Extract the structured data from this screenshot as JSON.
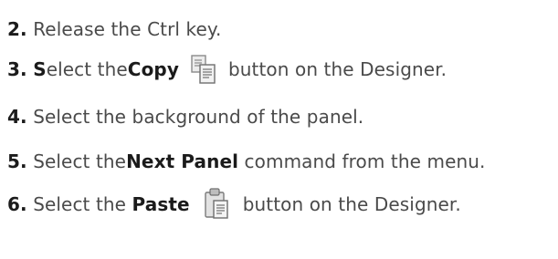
{
  "steps": [
    {
      "number": "2.",
      "before": "Release the Ctrl key.",
      "strong": "",
      "after": ""
    },
    {
      "number": "3.",
      "lead_strong": "S",
      "before": "elect the ",
      "strong": "Copy",
      "icon": "copy-icon",
      "after": "button on the Designer."
    },
    {
      "number": "4.",
      "before": "Select the background of the panel.",
      "strong": "",
      "after": ""
    },
    {
      "number": "5.",
      "before": "Select the ",
      "strong": "Next Panel",
      "after": " command from the menu."
    },
    {
      "number": "6.",
      "before": "Select the ",
      "strong": "Paste",
      "icon": "paste-icon",
      "after": "button on the Designer."
    }
  ],
  "colors": {
    "text": "#4a4a4a",
    "emphasis": "#1b1b1b",
    "icon_gray": "#8a8a8a",
    "icon_light": "#e6e6e6"
  }
}
